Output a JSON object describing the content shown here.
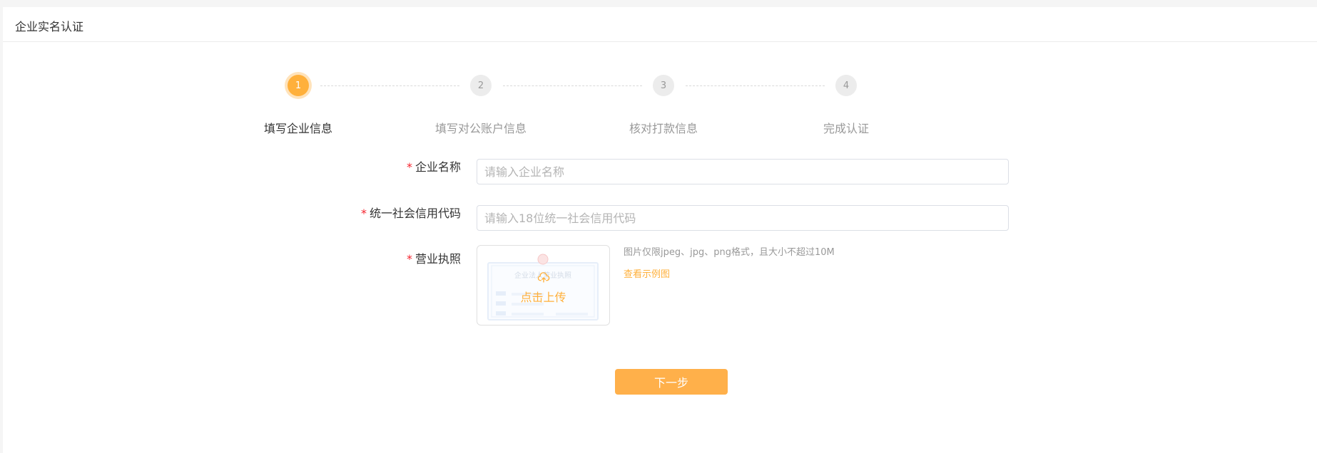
{
  "header": {
    "title": "企业实名认证"
  },
  "steps": [
    {
      "number": "1",
      "label": "填写企业信息",
      "active": true
    },
    {
      "number": "2",
      "label": "填写对公账户信息",
      "active": false
    },
    {
      "number": "3",
      "label": "核对打款信息",
      "active": false
    },
    {
      "number": "4",
      "label": "完成认证",
      "active": false
    }
  ],
  "form": {
    "required_mark": "*",
    "company_name": {
      "label": "企业名称",
      "value": "",
      "placeholder": "请输入企业名称"
    },
    "credit_code": {
      "label": "统一社会信用代码",
      "value": "",
      "placeholder": "请输入18位统一社会信用代码"
    },
    "business_license": {
      "label": "营业执照",
      "upload_text": "点击上传",
      "sample_caption": "企业法人营业执照",
      "hint": "图片仅限jpeg、jpg、png格式，且大小不超过10M",
      "example_link": "查看示例图"
    }
  },
  "actions": {
    "next_label": "下一步"
  },
  "colors": {
    "accent": "#ffb03b",
    "required": "#f5222d"
  }
}
